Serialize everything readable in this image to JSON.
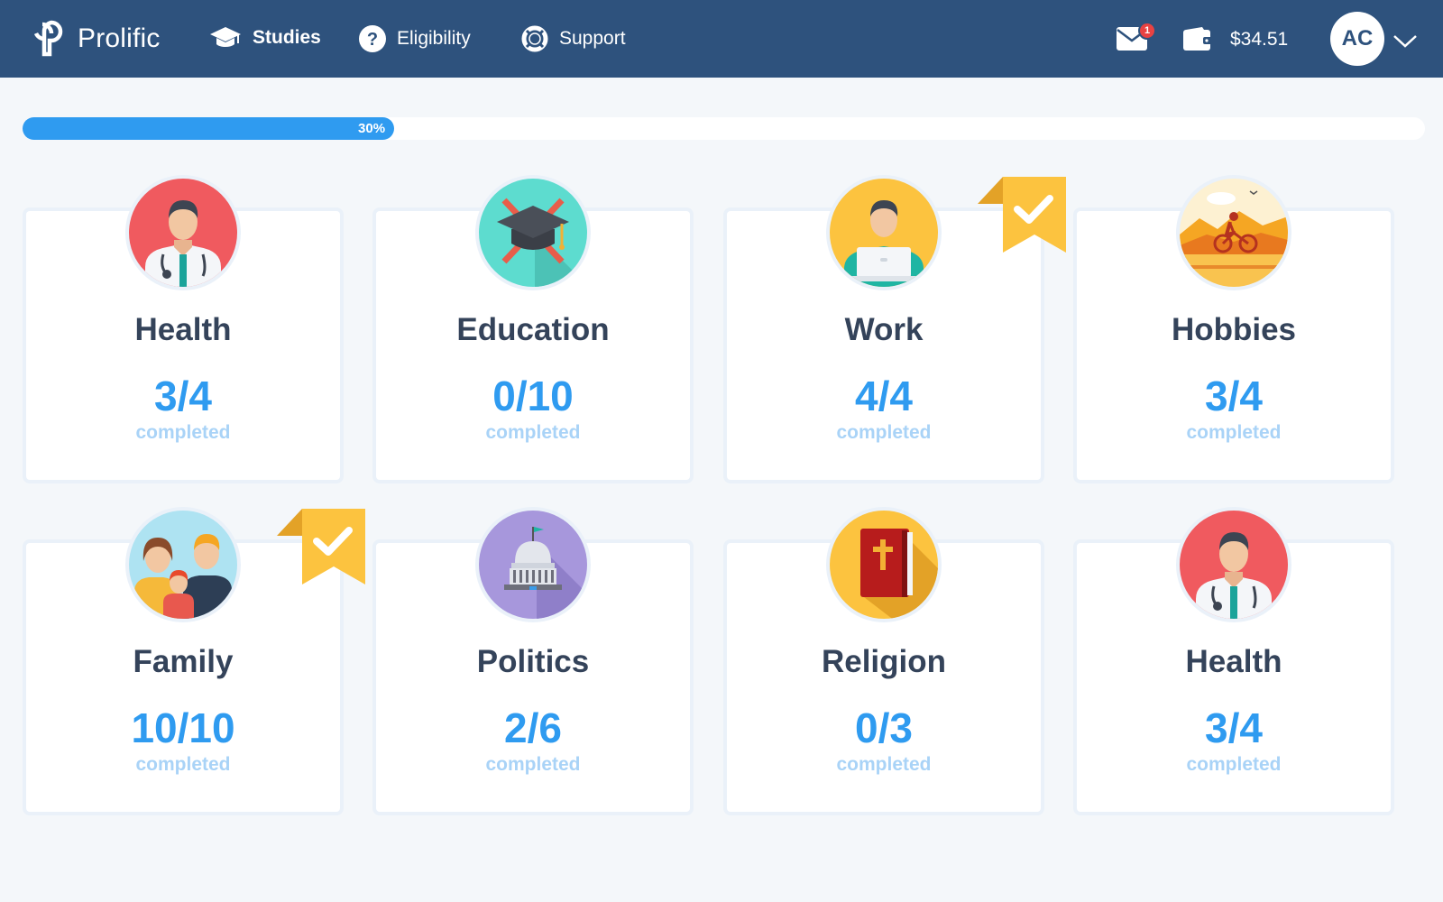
{
  "brand": {
    "name": "Prolific"
  },
  "nav": {
    "studies": "Studies",
    "eligibility": "Eligibility",
    "support": "Support"
  },
  "header": {
    "mail_badge": "1",
    "balance": "$34.51",
    "avatar_initials": "AC"
  },
  "progress": {
    "label": "30%",
    "fraction": 0.265
  },
  "completed_label": "completed",
  "cards": [
    {
      "title": "Health",
      "count": "3/4",
      "icon": "doctor-icon",
      "complete": false
    },
    {
      "title": "Education",
      "count": "0/10",
      "icon": "mortarboard-icon",
      "complete": false
    },
    {
      "title": "Work",
      "count": "4/4",
      "icon": "office-worker-icon",
      "complete": true
    },
    {
      "title": "Hobbies",
      "count": "3/4",
      "icon": "cyclist-icon",
      "complete": false
    },
    {
      "title": "Family",
      "count": "10/10",
      "icon": "family-icon",
      "complete": true
    },
    {
      "title": "Politics",
      "count": "2/6",
      "icon": "capitol-icon",
      "complete": false
    },
    {
      "title": "Religion",
      "count": "0/3",
      "icon": "bible-icon",
      "complete": false
    },
    {
      "title": "Health",
      "count": "3/4",
      "icon": "doctor-icon",
      "complete": false
    }
  ],
  "colors": {
    "navbar": "#2e527d",
    "accent": "#2f9bf0",
    "ribbon": "#fcc33f",
    "health_bg": "#f05a5f",
    "education_bg": "#5ddccf",
    "work_bg": "#fcc33f",
    "politics_bg": "#a797dc",
    "religion_bg": "#fcc33f"
  }
}
